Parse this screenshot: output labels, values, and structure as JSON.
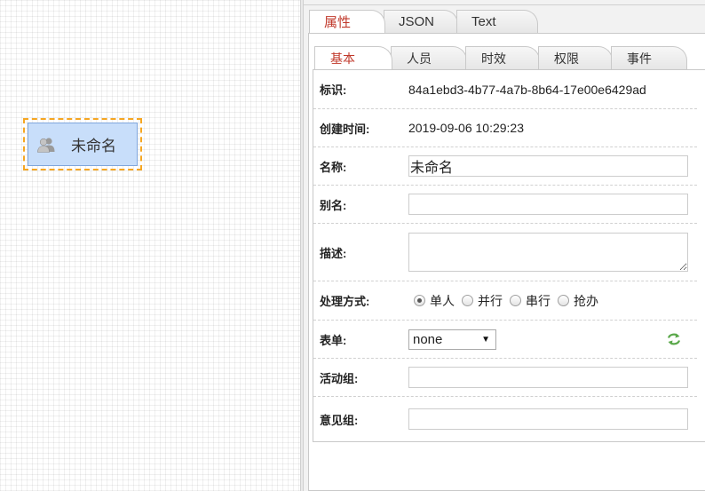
{
  "canvas": {
    "node": {
      "label": "未命名",
      "icon": "users-icon"
    }
  },
  "panel": {
    "outer_tabs": [
      "属性",
      "JSON",
      "Text"
    ],
    "inner_tabs": [
      "基本",
      "人员",
      "时效",
      "权限",
      "事件"
    ],
    "fields": {
      "id_label": "标识:",
      "id_value": "84a1ebd3-4b77-4a7b-8b64-17e00e6429ad",
      "created_label": "创建时间:",
      "created_value": "2019-09-06 10:29:23",
      "name_label": "名称:",
      "name_value": "未命名",
      "alias_label": "别名:",
      "alias_value": "",
      "desc_label": "描述:",
      "desc_value": "",
      "mode_label": "处理方式:",
      "mode_options": [
        "单人",
        "并行",
        "串行",
        "抢办"
      ],
      "mode_selected": "单人",
      "form_label": "表单:",
      "form_value": "none",
      "form_refresh_icon": "refresh-icon",
      "active_group_label": "活动组:",
      "active_group_value": "",
      "opinion_group_label": "意见组:",
      "opinion_group_value": ""
    },
    "colors": {
      "active_tab": "#c0392b",
      "node_fill": "#c8defa",
      "node_outline": "#f5a623",
      "refresh": "#5aa84a"
    }
  }
}
